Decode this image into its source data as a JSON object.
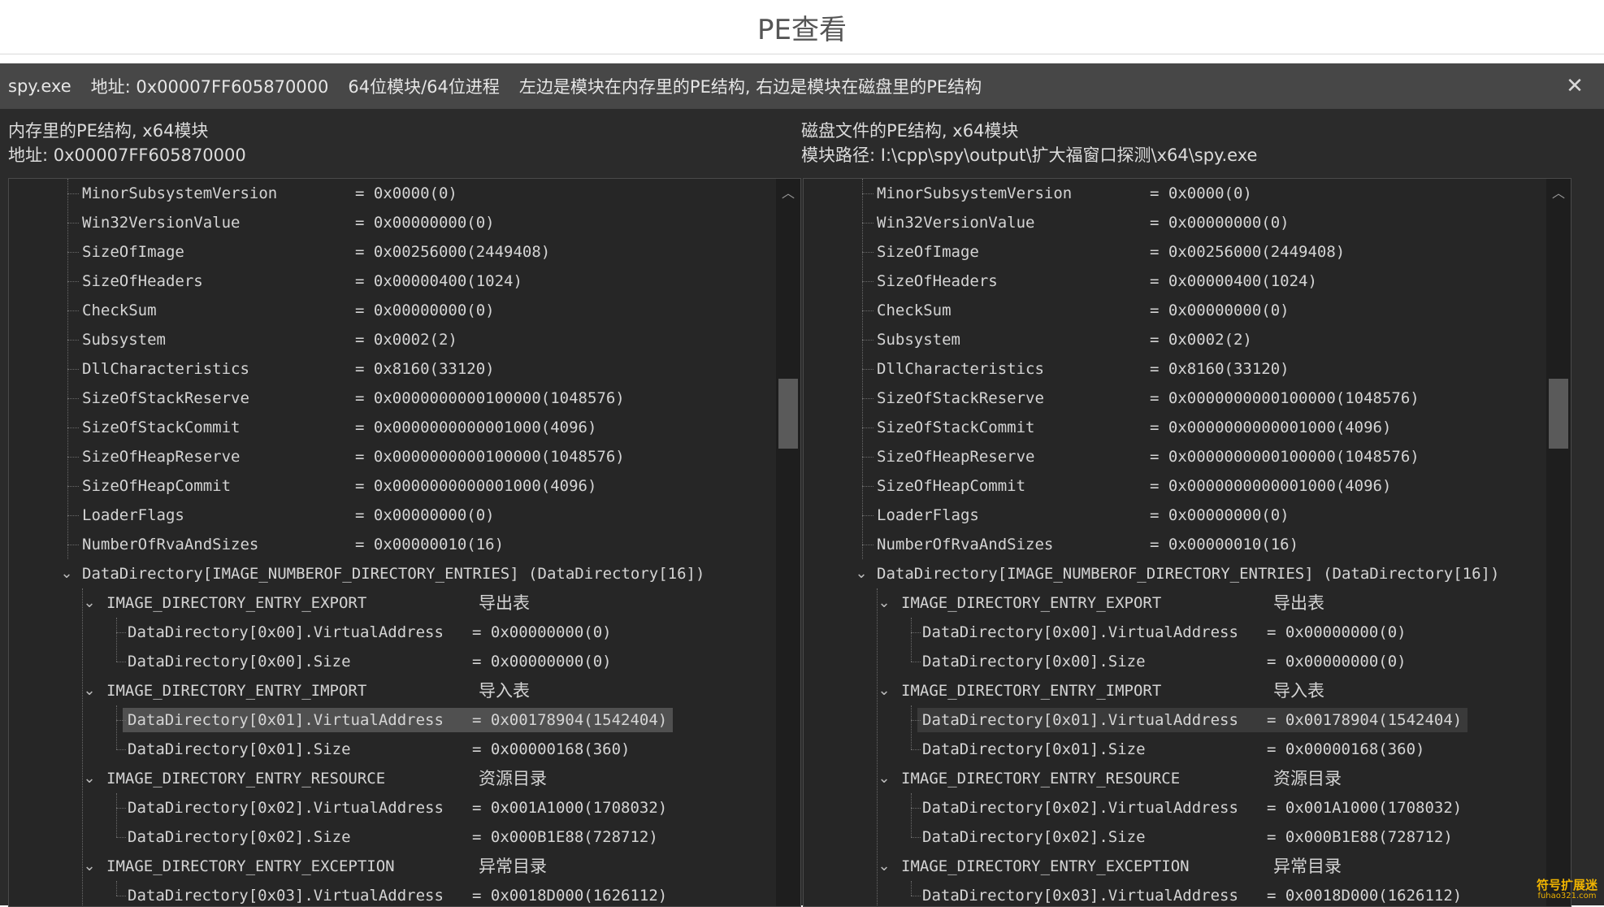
{
  "page_title": "PE查看",
  "titlebar": {
    "exe": "spy.exe",
    "address": "地址: 0x00007FF605870000",
    "bits": "64位模块/64位进程",
    "description": "左边是模块在内存里的PE结构, 右边是模块在磁盘里的PE结构",
    "close_icon": "close-icon"
  },
  "left": {
    "header_line1": "内存里的PE结构, x64模块",
    "header_line2": "地址: 0x00007FF605870000"
  },
  "right": {
    "header_line1": "磁盘文件的PE结构, x64模块",
    "header_line2": "模块路径: I:\\cpp\\spy\\output\\扩大福窗口探测\\x64\\spy.exe"
  },
  "fields": [
    {
      "name": "MinorSubsystemVersion",
      "value": "= 0x0000(0)"
    },
    {
      "name": "Win32VersionValue",
      "value": "= 0x00000000(0)"
    },
    {
      "name": "SizeOfImage",
      "value": "= 0x00256000(2449408)"
    },
    {
      "name": "SizeOfHeaders",
      "value": "= 0x00000400(1024)"
    },
    {
      "name": "CheckSum",
      "value": "= 0x00000000(0)"
    },
    {
      "name": "Subsystem",
      "value": "= 0x0002(2)"
    },
    {
      "name": "DllCharacteristics",
      "value": "= 0x8160(33120)"
    },
    {
      "name": "SizeOfStackReserve",
      "value": "= 0x0000000000100000(1048576)"
    },
    {
      "name": "SizeOfStackCommit",
      "value": "= 0x0000000000001000(4096)"
    },
    {
      "name": "SizeOfHeapReserve",
      "value": "= 0x0000000000100000(1048576)"
    },
    {
      "name": "SizeOfHeapCommit",
      "value": "= 0x0000000000001000(4096)"
    },
    {
      "name": "LoaderFlags",
      "value": "= 0x00000000(0)"
    },
    {
      "name": "NumberOfRvaAndSizes",
      "value": "= 0x00000010(16)"
    }
  ],
  "data_directory_label": "DataDirectory[IMAGE_NUMBEROF_DIRECTORY_ENTRIES] (DataDirectory[16])",
  "groups": [
    {
      "name": "IMAGE_DIRECTORY_ENTRY_EXPORT",
      "cn": "导出表",
      "children": [
        {
          "name": "DataDirectory[0x00].VirtualAddress",
          "value": "= 0x00000000(0)"
        },
        {
          "name": "DataDirectory[0x00].Size",
          "value": "= 0x00000000(0)"
        }
      ]
    },
    {
      "name": "IMAGE_DIRECTORY_ENTRY_IMPORT",
      "cn": "导入表",
      "children": [
        {
          "name": "DataDirectory[0x01].VirtualAddress",
          "value": "= 0x00178904(1542404)"
        },
        {
          "name": "DataDirectory[0x01].Size",
          "value": "= 0x00000168(360)"
        }
      ]
    },
    {
      "name": "IMAGE_DIRECTORY_ENTRY_RESOURCE",
      "cn": "资源目录",
      "children": [
        {
          "name": "DataDirectory[0x02].VirtualAddress",
          "value": "= 0x001A1000(1708032)"
        },
        {
          "name": "DataDirectory[0x02].Size",
          "value": "= 0x000B1E88(728712)"
        }
      ]
    },
    {
      "name": "IMAGE_DIRECTORY_ENTRY_EXCEPTION",
      "cn": "异常目录",
      "children": [
        {
          "name": "DataDirectory[0x03].VirtualAddress",
          "value": "= 0x0018D000(1626112)"
        }
      ]
    }
  ],
  "scroll_up_icon": "chevron-up-icon",
  "expand_icon": "chevron-down-icon",
  "watermark": {
    "text": "符号扩展迷",
    "url": "fuhao321.com"
  }
}
